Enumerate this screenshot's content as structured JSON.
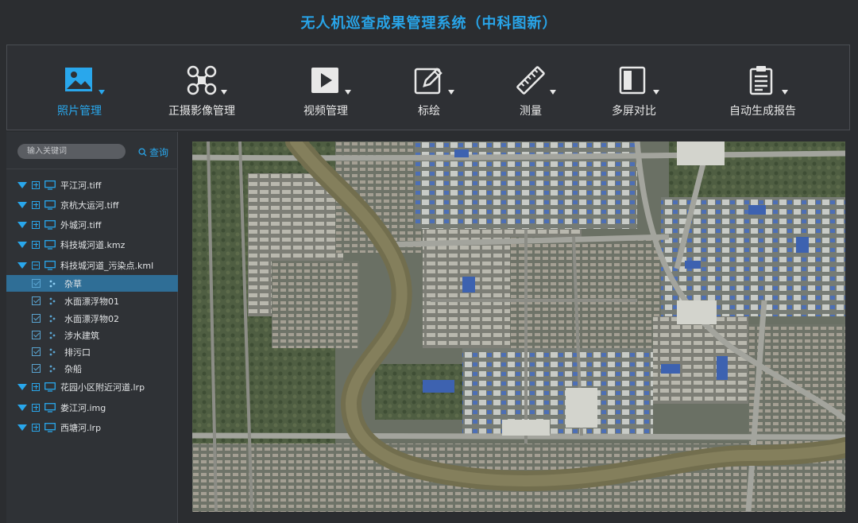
{
  "app": {
    "title": "无人机巡查成果管理系统（中科图新）"
  },
  "toolbar": {
    "items": [
      {
        "label": "照片管理",
        "icon": "photo-icon",
        "active": true
      },
      {
        "label": "正摄影像管理",
        "icon": "drone-icon",
        "active": false
      },
      {
        "label": "视频管理",
        "icon": "video-play-icon",
        "active": false
      },
      {
        "label": "标绘",
        "icon": "edit-icon",
        "active": false
      },
      {
        "label": "测量",
        "icon": "ruler-icon",
        "active": false
      },
      {
        "label": "多屏对比",
        "icon": "split-screen-icon",
        "active": false
      },
      {
        "label": "自动生成报告",
        "icon": "clipboard-report-icon",
        "active": false
      }
    ]
  },
  "sidebar": {
    "search": {
      "placeholder": "输入关键词",
      "button_label": "查询",
      "value": ""
    },
    "tree": [
      {
        "label": "平江河.tiff",
        "level": 0,
        "expanded": false
      },
      {
        "label": "京杭大运河.tiff",
        "level": 0,
        "expanded": false
      },
      {
        "label": "外城河.tiff",
        "level": 0,
        "expanded": false
      },
      {
        "label": "科技城河道.kmz",
        "level": 0,
        "expanded": false
      },
      {
        "label": "科技城河道_污染点.kml",
        "level": 0,
        "expanded": true
      },
      {
        "label": "杂草",
        "level": 1,
        "checked": true,
        "selected": true
      },
      {
        "label": "水面漂浮物01",
        "level": 1,
        "checked": true,
        "selected": false
      },
      {
        "label": "水面漂浮物02",
        "level": 1,
        "checked": true,
        "selected": false
      },
      {
        "label": "涉水建筑",
        "level": 1,
        "checked": true,
        "selected": false
      },
      {
        "label": "排污口",
        "level": 1,
        "checked": true,
        "selected": false
      },
      {
        "label": "杂船",
        "level": 1,
        "checked": true,
        "selected": false
      },
      {
        "label": "花园小区附近河道.lrp",
        "level": 0,
        "expanded": false
      },
      {
        "label": "娄江河.img",
        "level": 0,
        "expanded": false
      },
      {
        "label": "西塘河.lrp",
        "level": 0,
        "expanded": false
      }
    ]
  },
  "colors": {
    "accent": "#29a7ec",
    "background": "#2b2d30",
    "panel": "#2f3236",
    "selected_row": "#2f6e96",
    "title": "#28a4e8"
  }
}
